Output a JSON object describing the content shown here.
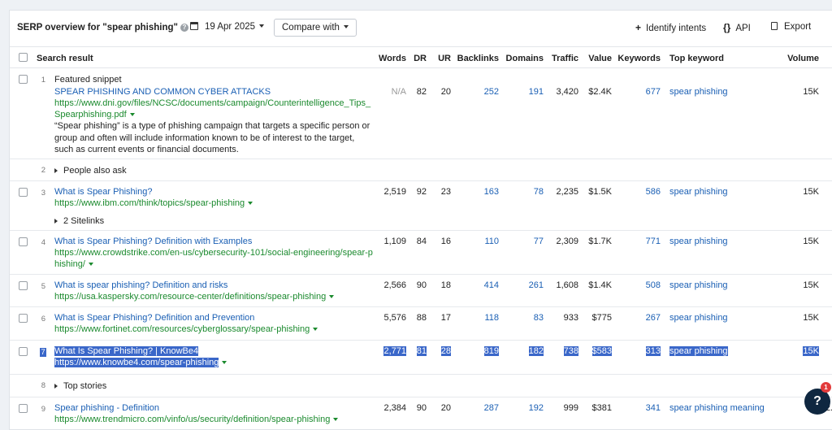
{
  "toolbar": {
    "title": "SERP overview for \"spear phishing\"",
    "date": "19 Apr 2025",
    "compare_label": "Compare with",
    "identify_label": "Identify intents",
    "api_label": "API",
    "export_label": "Export"
  },
  "columns": {
    "result": "Search result",
    "words": "Words",
    "dr": "DR",
    "ur": "UR",
    "backlinks": "Backlinks",
    "domains": "Domains",
    "traffic": "Traffic",
    "value": "Value",
    "keywords": "Keywords",
    "top_keyword": "Top keyword",
    "volume": "Volume"
  },
  "rows": [
    {
      "rank": "1",
      "label": "Featured snippet",
      "title": "SPEAR PHISHING AND COMMON CYBER ATTACKS",
      "url_line1": "https://www.dni.gov/files/NCSC/documents/campaign/Counterintelligence_Tips_",
      "url_line2": "Spearphishing.pdf",
      "snippet_1": "“Spear phishing” is a type of phishing campaign that targets a specific person or",
      "snippet_2": "group and often will include information known to be of interest to the target,",
      "snippet_3": "such as current events or financial documents.",
      "words": "N/A",
      "dr": "82",
      "ur": "20",
      "backlinks": "252",
      "domains": "191",
      "traffic": "3,420",
      "value": "$2.4K",
      "keywords": "677",
      "top_keyword": "spear phishing",
      "volume": "15K"
    },
    {
      "rank": "2",
      "label": "People also ask"
    },
    {
      "rank": "3",
      "title": "What is Spear Phishing?",
      "url": "https://www.ibm.com/think/topics/spear-phishing",
      "sitelinks": "2 Sitelinks",
      "words": "2,519",
      "dr": "92",
      "ur": "23",
      "backlinks": "163",
      "domains": "78",
      "traffic": "2,235",
      "value": "$1.5K",
      "keywords": "586",
      "top_keyword": "spear phishing",
      "volume": "15K"
    },
    {
      "rank": "4",
      "title": "What is Spear Phishing? Definition with Examples",
      "url_line1": "https://www.crowdstrike.com/en-us/cybersecurity-101/social-engineering/spear-p",
      "url_line2": "hishing/",
      "words": "1,109",
      "dr": "84",
      "ur": "16",
      "backlinks": "110",
      "domains": "77",
      "traffic": "2,309",
      "value": "$1.7K",
      "keywords": "771",
      "top_keyword": "spear phishing",
      "volume": "15K"
    },
    {
      "rank": "5",
      "title": "What is spear phishing? Definition and risks",
      "url": "https://usa.kaspersky.com/resource-center/definitions/spear-phishing",
      "words": "2,566",
      "dr": "90",
      "ur": "18",
      "backlinks": "414",
      "domains": "261",
      "traffic": "1,608",
      "value": "$1.4K",
      "keywords": "508",
      "top_keyword": "spear phishing",
      "volume": "15K"
    },
    {
      "rank": "6",
      "title": "What is Spear Phishing? Definition and Prevention",
      "url": "https://www.fortinet.com/resources/cyberglossary/spear-phishing",
      "words": "5,576",
      "dr": "88",
      "ur": "17",
      "backlinks": "118",
      "domains": "83",
      "traffic": "933",
      "value": "$775",
      "keywords": "267",
      "top_keyword": "spear phishing",
      "volume": "15K"
    },
    {
      "rank": "7",
      "title": "What Is Spear Phishing? | KnowBe4",
      "url": "https://www.knowbe4.com/spear-phishing",
      "words": "2,771",
      "dr": "81",
      "ur": "28",
      "backlinks": "819",
      "domains": "182",
      "traffic": "738",
      "value": "$583",
      "keywords": "313",
      "top_keyword": "spear phishing",
      "volume": "15K"
    },
    {
      "rank": "8",
      "label": "Top stories"
    },
    {
      "rank": "9",
      "title": "Spear phishing - Definition",
      "url": "https://www.trendmicro.com/vinfo/us/security/definition/spear-phishing",
      "words": "2,384",
      "dr": "90",
      "ur": "20",
      "backlinks": "287",
      "domains": "192",
      "traffic": "999",
      "value": "$381",
      "keywords": "341",
      "top_keyword": "spear phishing meaning",
      "volume": "2."
    }
  ],
  "help": {
    "label": "?",
    "badge": "1"
  }
}
